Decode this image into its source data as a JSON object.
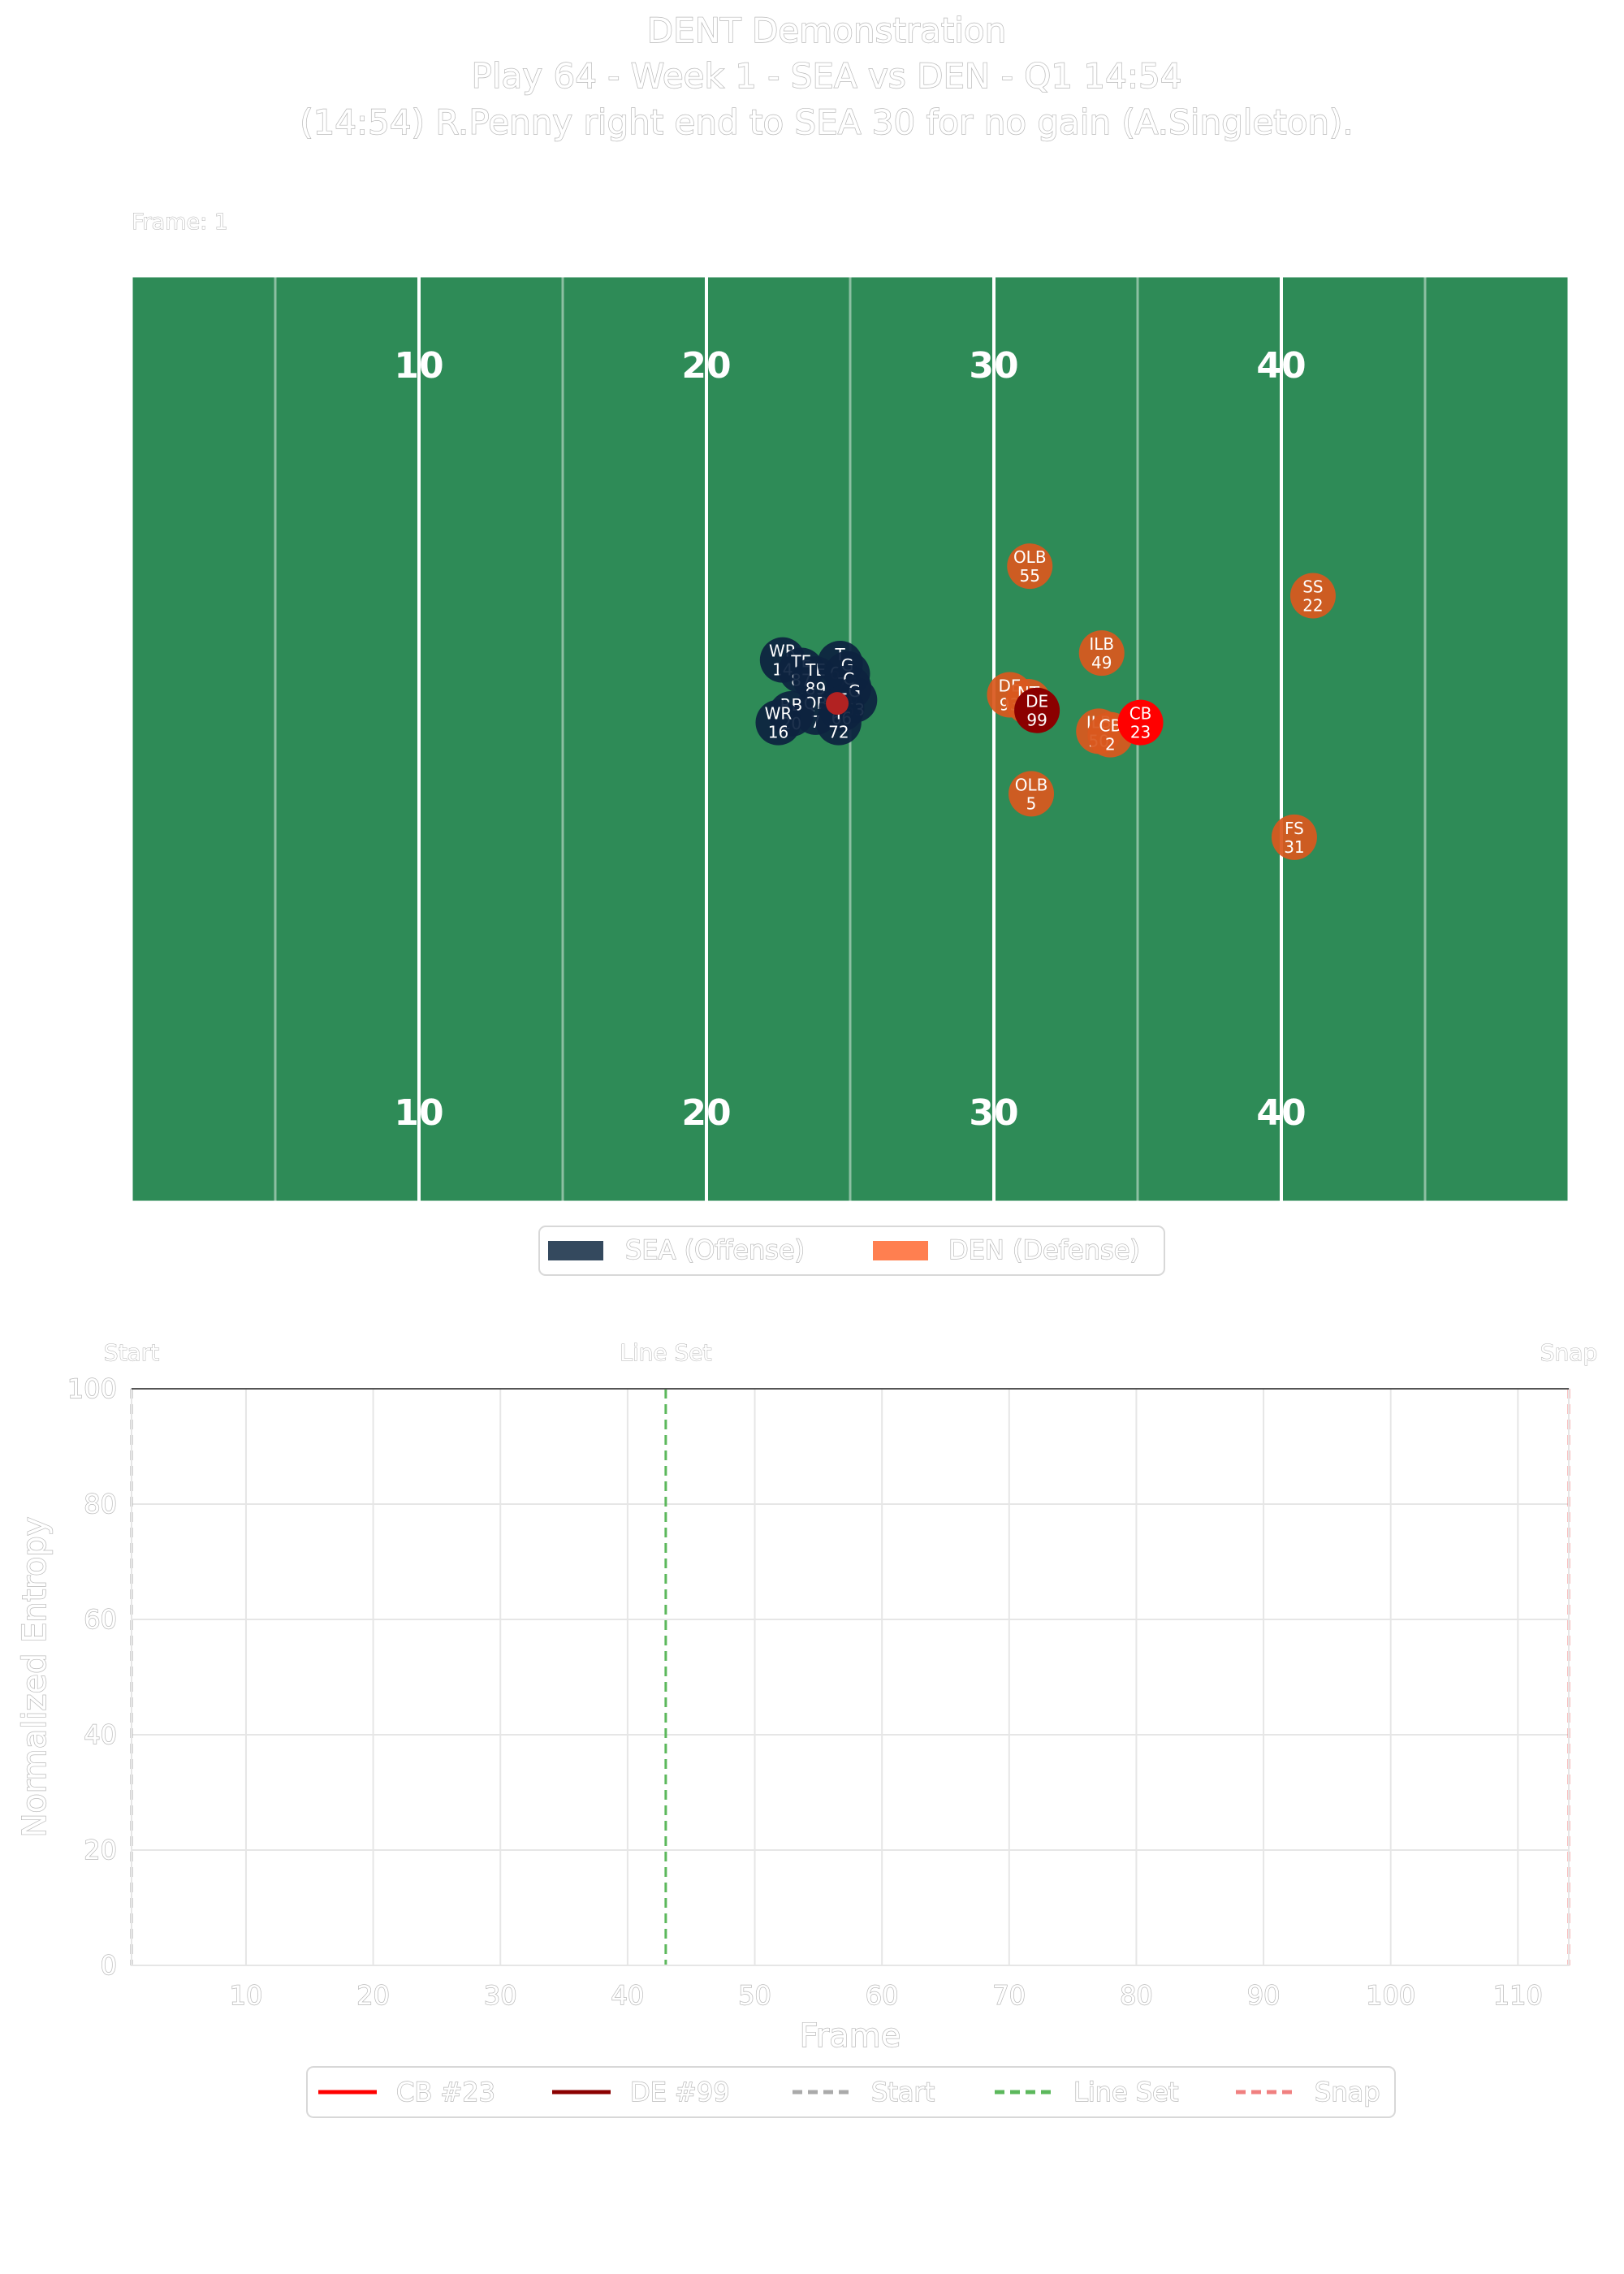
{
  "header": {
    "title_line1": "DENT Demonstration",
    "title_line2": "Play 64 - Week 1 - SEA vs DEN - Q1 14:54",
    "title_line3": "(14:54) R.Penny right end to SEA 30 for no gain (A.Singleton).",
    "frame_label": "Frame: 1"
  },
  "colors": {
    "field": "#2e8b57",
    "offense": "#0d2240",
    "offense_legend": "#34495e",
    "defense": "#d9581e",
    "defense_legend": "#ff7f50",
    "cb_highlight": "#ff0000",
    "de_highlight": "#8b0000",
    "ball": "#b22222",
    "start_line": "#aaaaaa",
    "lineset_line": "#5cb85c",
    "snap_line": "#f08080"
  },
  "field_numbers": [
    "10",
    "20",
    "30",
    "40"
  ],
  "field_legend": {
    "offense": "SEA (Offense)",
    "defense": "DEN (Defense)"
  },
  "chart_data": [
    {
      "type": "scatter",
      "title": "",
      "xlim": [
        0,
        100
      ],
      "ylim": [
        0,
        53.3
      ],
      "x_units": "yards from left end line of shown field",
      "ball": {
        "x": 49.1,
        "y": 28.7
      },
      "players": [
        {
          "pos": "WR",
          "num": "14",
          "team": "offense",
          "x": 45.3,
          "y": 31.2
        },
        {
          "pos": "TE",
          "num": "87",
          "team": "offense",
          "x": 46.6,
          "y": 30.6
        },
        {
          "pos": "TE",
          "num": "89",
          "team": "offense",
          "x": 47.6,
          "y": 30.1
        },
        {
          "pos": "QB",
          "num": "7",
          "team": "offense",
          "x": 47.6,
          "y": 28.2
        },
        {
          "pos": "RB",
          "num": "20",
          "team": "offense",
          "x": 45.9,
          "y": 28.1
        },
        {
          "pos": "WR",
          "num": "16",
          "team": "offense",
          "x": 45.0,
          "y": 27.6
        },
        {
          "pos": "T",
          "num": "67",
          "team": "offense",
          "x": 49.3,
          "y": 31.0
        },
        {
          "pos": "G",
          "num": "76",
          "team": "offense",
          "x": 49.8,
          "y": 30.4
        },
        {
          "pos": "C",
          "num": "60",
          "team": "offense",
          "x": 49.9,
          "y": 29.6
        },
        {
          "pos": "G",
          "num": "63",
          "team": "offense",
          "x": 50.3,
          "y": 28.9
        },
        {
          "pos": "T",
          "num": "66",
          "team": "offense",
          "x": 49.4,
          "y": 28.4
        },
        {
          "pos": "T",
          "num": "72",
          "team": "offense",
          "x": 49.2,
          "y": 27.6
        },
        {
          "pos": "DE",
          "num": "93",
          "team": "defense",
          "x": 61.1,
          "y": 29.2
        },
        {
          "pos": "NT",
          "num": "97",
          "team": "defense",
          "x": 62.4,
          "y": 28.8
        },
        {
          "pos": "DE",
          "num": "99",
          "team": "defense",
          "x": 63.0,
          "y": 28.3,
          "highlight": "de"
        },
        {
          "pos": "OLB",
          "num": "55",
          "team": "defense",
          "x": 62.5,
          "y": 36.6
        },
        {
          "pos": "OLB",
          "num": "5",
          "team": "defense",
          "x": 62.6,
          "y": 23.5
        },
        {
          "pos": "ILB",
          "num": "49",
          "team": "defense",
          "x": 67.5,
          "y": 31.6
        },
        {
          "pos": "ILB",
          "num": "50",
          "team": "defense",
          "x": 67.3,
          "y": 27.1
        },
        {
          "pos": "CB",
          "num": "2",
          "team": "defense",
          "x": 68.1,
          "y": 26.9
        },
        {
          "pos": "CB",
          "num": "23",
          "team": "defense",
          "x": 70.2,
          "y": 27.6,
          "highlight": "cb"
        },
        {
          "pos": "SS",
          "num": "22",
          "team": "defense",
          "x": 82.2,
          "y": 34.9
        },
        {
          "pos": "FS",
          "num": "31",
          "team": "defense",
          "x": 80.9,
          "y": 21.0
        }
      ]
    },
    {
      "type": "line",
      "title": "",
      "xlabel": "Frame",
      "ylabel": "Normalized Entropy",
      "xlim": [
        1,
        114
      ],
      "ylim": [
        0,
        100
      ],
      "xticks": [
        10,
        20,
        30,
        40,
        50,
        60,
        70,
        80,
        90,
        100,
        110
      ],
      "yticks": [
        0,
        20,
        40,
        60,
        80,
        100
      ],
      "grid": true,
      "legend_position": "bottom-center",
      "series": [
        {
          "name": "CB #23",
          "color": "#ff0000",
          "x": [],
          "y": []
        },
        {
          "name": "DE #99",
          "color": "#8b0000",
          "x": [],
          "y": []
        }
      ],
      "events": [
        {
          "name": "Start",
          "label": "Start",
          "frame": 1,
          "color": "#aaaaaa"
        },
        {
          "name": "Line Set",
          "label": "Line Set",
          "frame": 43,
          "color": "#5cb85c"
        },
        {
          "name": "Snap",
          "label": "Snap",
          "frame": 114,
          "color": "#f08080"
        }
      ]
    }
  ]
}
